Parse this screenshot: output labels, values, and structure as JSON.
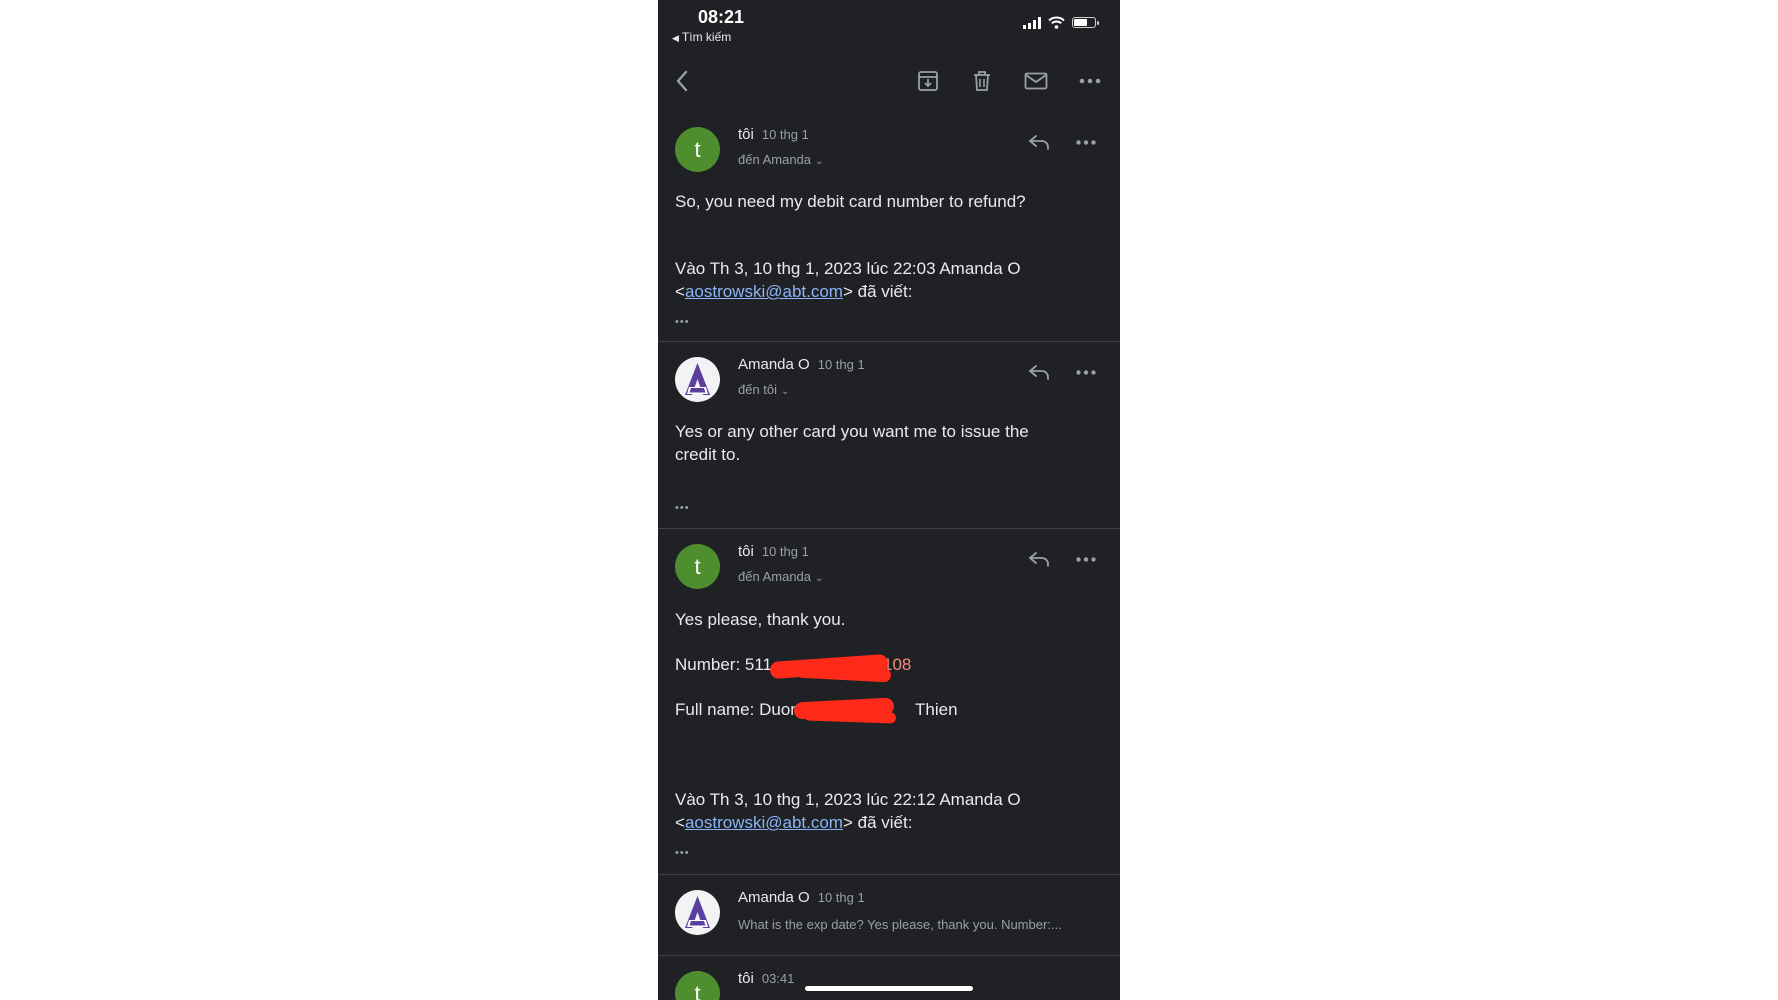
{
  "status_bar": {
    "time": "08:21",
    "back_label": "Tìm kiếm"
  },
  "colors": {
    "background": "#202124",
    "link": "#8ab4f8",
    "avatar_green": "#4e8e2e",
    "avatar_amanda": "#5b3f9e",
    "redaction": "#ff2a1a"
  },
  "toolbar": {
    "icons": [
      "back-icon",
      "archive-icon",
      "trash-icon",
      "mail-icon",
      "more-icon"
    ]
  },
  "messages": [
    {
      "avatar_letter": "t",
      "sender": "tôi",
      "date": "10 thg 1",
      "to": "đến Amanda",
      "body": "So, you need my debit card number to refund?",
      "quote_line1": "Vào Th 3, 10 thg 1, 2023 lúc 22:03 Amanda O",
      "quote_email": "aostrowski@abt.com",
      "quote_suffix": "> đã viết:",
      "ellipsis": "•••"
    },
    {
      "avatar_letter": "A",
      "sender": "Amanda O",
      "date": "10 thg 1",
      "to": "đến tôi",
      "body": "Yes or any other card you want me to issue the credit to.",
      "ellipsis": "•••"
    },
    {
      "avatar_letter": "t",
      "sender": "tôi",
      "date": "10 thg 1",
      "to": "đến Amanda",
      "body": "Yes please, thank you.",
      "number_label": "Number: 511",
      "number_tail": "108",
      "fullname_label": "Full name: Duon",
      "fullname_tail": "Thien",
      "quote_line1": "Vào Th 3, 10 thg 1, 2023 lúc 22:12 Amanda O",
      "quote_email": "aostrowski@abt.com",
      "quote_suffix": "> đã viết:",
      "ellipsis": "•••"
    },
    {
      "avatar_letter": "A",
      "sender": "Amanda O",
      "date": "10 thg 1",
      "snippet": "What is the exp date? Yes please, thank you. Number:..."
    },
    {
      "avatar_letter": "t",
      "sender": "tôi",
      "date": "03:41"
    }
  ]
}
